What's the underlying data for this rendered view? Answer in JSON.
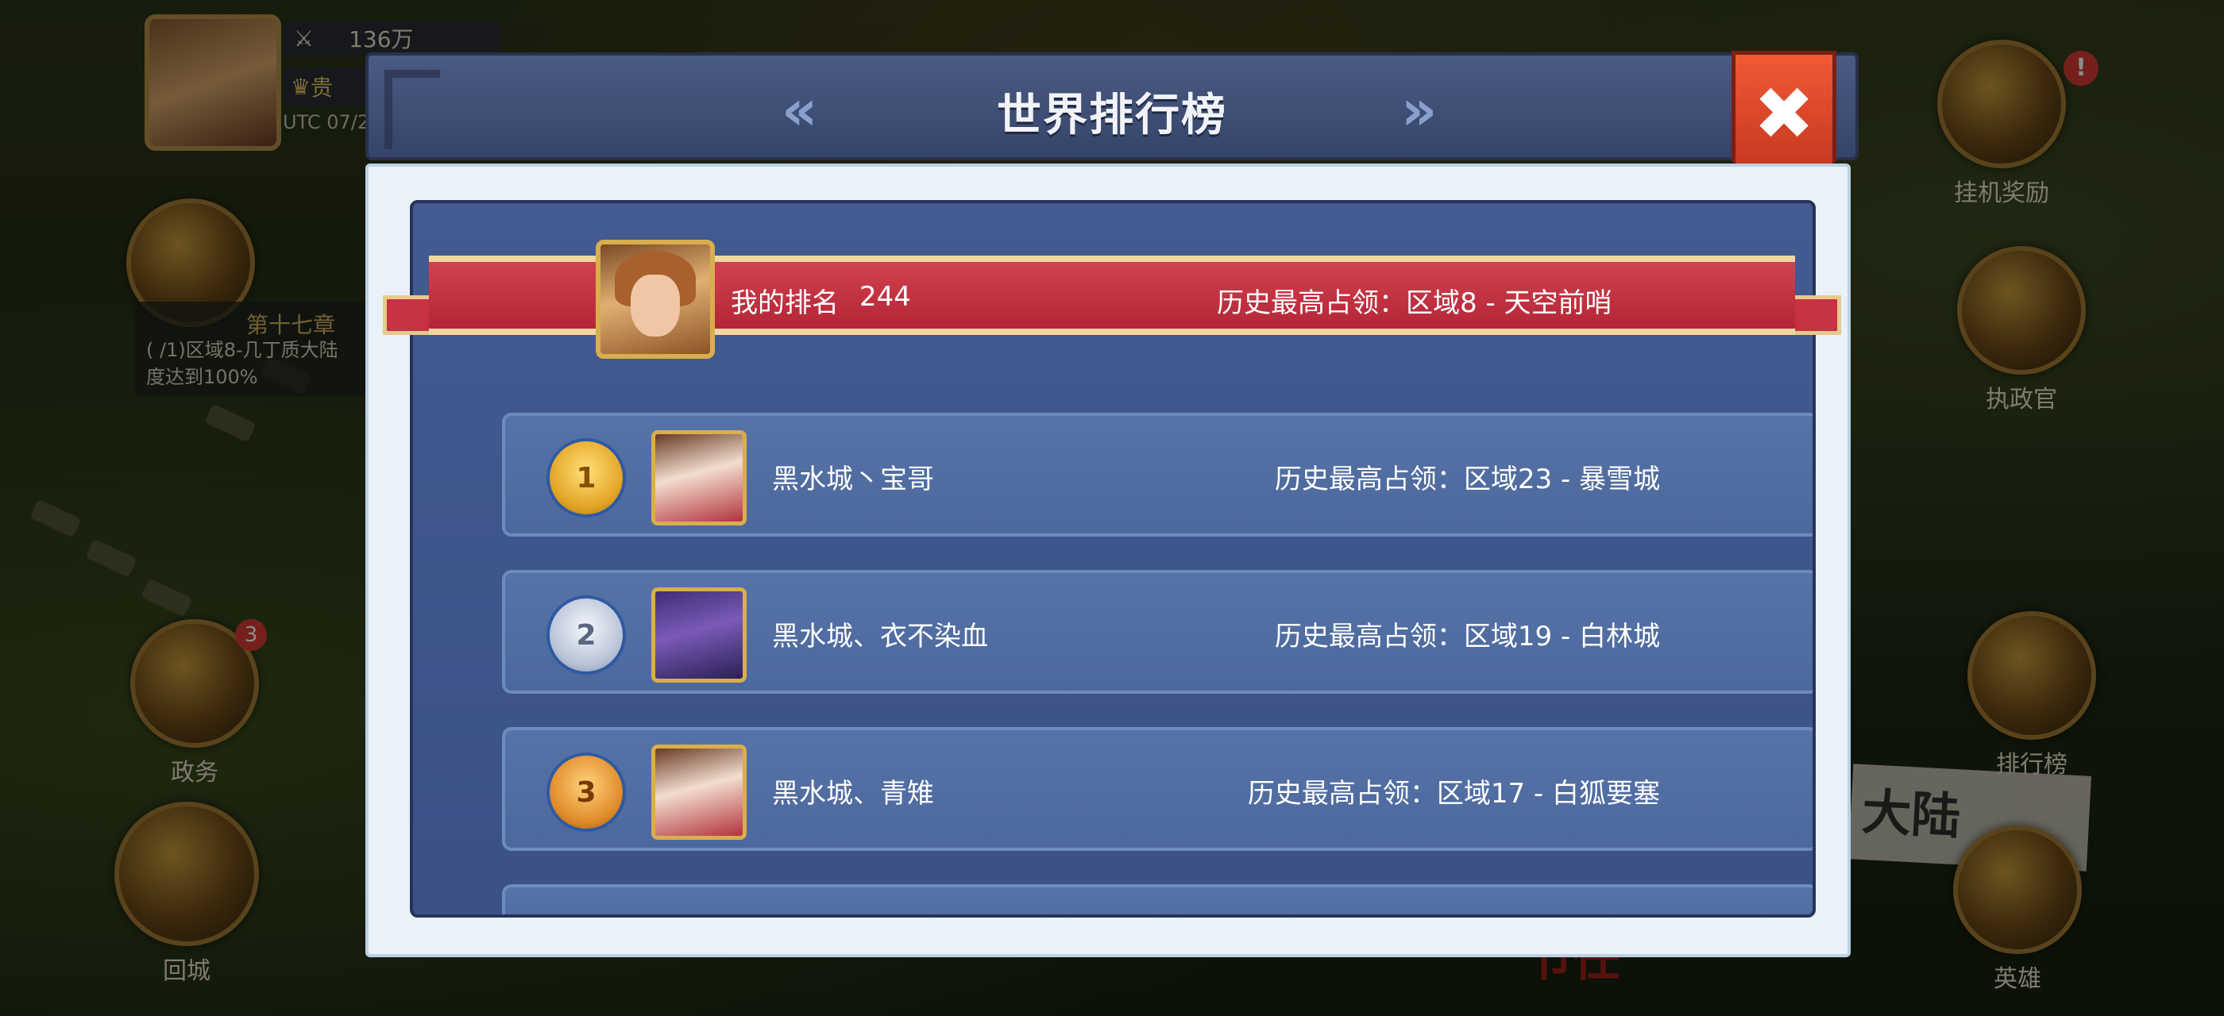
{
  "hud": {
    "power": "136万",
    "vip_label": "贵",
    "utc_text": "UTC 07/2",
    "chapter": "第十七章",
    "quest_text": "( /1)区域8-几丁质大陆",
    "quest_progress_text": "度达到100%",
    "left_buttons": [
      "政务",
      "回城"
    ],
    "right_buttons": [
      "挂机奖励",
      "执政官",
      "排行榜",
      "英雄"
    ],
    "map_banner": "大陆",
    "bottom_text": "节任",
    "badge_count": "3",
    "alert_mark": "!"
  },
  "modal": {
    "title": "世界排行榜",
    "prev_arrow": "«",
    "next_arrow": "»",
    "close_icon": "✖"
  },
  "my_rank": {
    "label": "我的排名",
    "rank": "244",
    "record": "历史最高占领：区域8 - 天空前哨"
  },
  "rows": [
    {
      "rank": "1",
      "name": "黑水城丶宝哥",
      "record": "历史最高占领：区域23 - 暴雪城",
      "crown": "gold"
    },
    {
      "rank": "2",
      "name": "黑水城、衣不染血",
      "record": "历史最高占领：区域19 - 白林城",
      "crown": "silver"
    },
    {
      "rank": "3",
      "name": "黑水城、青雉",
      "record": "历史最高占领：区域17 - 白狐要塞",
      "crown": "bronze"
    }
  ],
  "colors": {
    "panel_blue": "#435b91",
    "ribbon_red": "#c63144",
    "close_orange": "#f05a34",
    "gold_frame": "#d8ae4f"
  }
}
